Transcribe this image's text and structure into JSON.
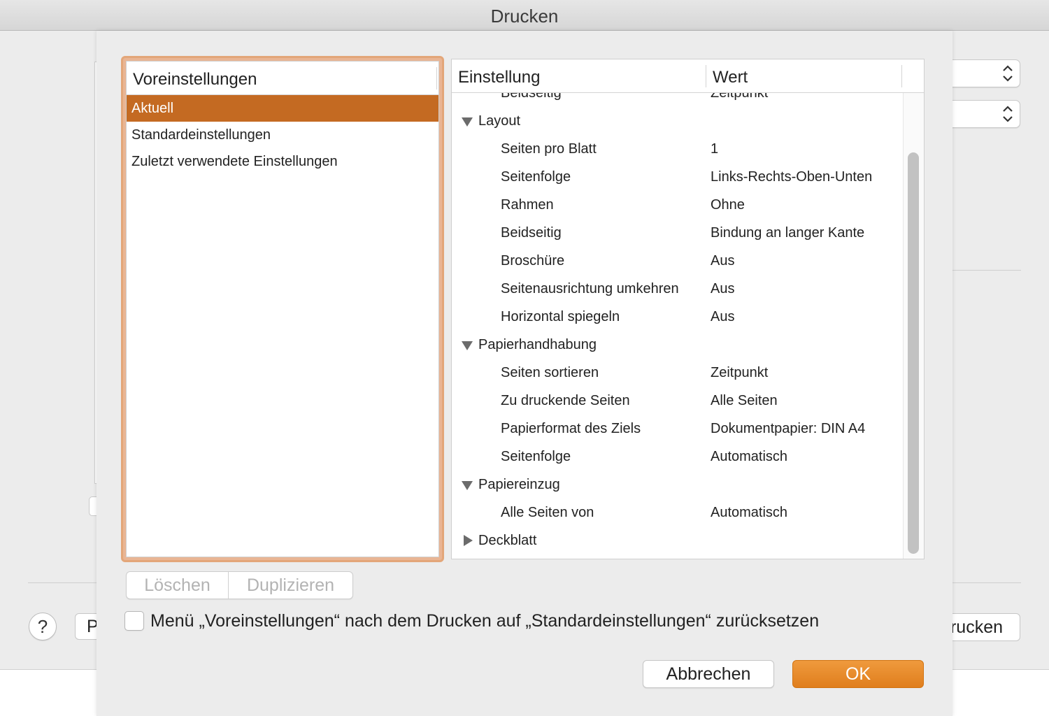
{
  "window": {
    "title": "Drucken"
  },
  "background": {
    "help_label": "?",
    "left_button_label": "P",
    "right_button_label": "Drucken"
  },
  "presets": {
    "header": "Voreinstellungen",
    "items": [
      {
        "label": "Aktuell",
        "selected": true
      },
      {
        "label": "Standardeinstellungen",
        "selected": false
      },
      {
        "label": "Zuletzt verwendete Einstellungen",
        "selected": false
      }
    ],
    "delete_label": "Löschen",
    "duplicate_label": "Duplizieren"
  },
  "settings": {
    "header_setting": "Einstellung",
    "header_value": "Wert",
    "partial_row": {
      "key": "Beidseitig",
      "value": "Zeitpunkt"
    },
    "rows": [
      {
        "type": "group",
        "key": "Layout",
        "expanded": true
      },
      {
        "type": "item",
        "key": "Seiten pro Blatt",
        "value": "1"
      },
      {
        "type": "item",
        "key": "Seitenfolge",
        "value": "Links-Rechts-Oben-Unten"
      },
      {
        "type": "item",
        "key": "Rahmen",
        "value": "Ohne"
      },
      {
        "type": "item",
        "key": "Beidseitig",
        "value": "Bindung an langer Kante"
      },
      {
        "type": "item",
        "key": "Broschüre",
        "value": "Aus"
      },
      {
        "type": "item",
        "key": "Seitenausrichtung umkehren",
        "value": "Aus"
      },
      {
        "type": "item",
        "key": "Horizontal spiegeln",
        "value": "Aus"
      },
      {
        "type": "group",
        "key": "Papierhandhabung",
        "expanded": true
      },
      {
        "type": "item",
        "key": "Seiten sortieren",
        "value": "Zeitpunkt"
      },
      {
        "type": "item",
        "key": "Zu druckende Seiten",
        "value": "Alle Seiten"
      },
      {
        "type": "item",
        "key": "Papierformat des Ziels",
        "value": "Dokumentpapier: DIN A4"
      },
      {
        "type": "item",
        "key": "Seitenfolge",
        "value": "Automatisch"
      },
      {
        "type": "group",
        "key": "Papiereinzug",
        "expanded": true
      },
      {
        "type": "item",
        "key": "Alle Seiten von",
        "value": "Automatisch"
      },
      {
        "type": "group",
        "key": "Deckblatt",
        "expanded": false
      }
    ]
  },
  "reset_option": {
    "label": "Menü „Voreinstellungen“ nach dem Drucken auf „Standardeinstellungen“ zurücksetzen",
    "checked": false
  },
  "footer": {
    "cancel_label": "Abbrechen",
    "ok_label": "OK"
  },
  "colors": {
    "accent": "#c46a22",
    "focus_ring": "#e3a679",
    "ok_button": "#e8891f"
  }
}
